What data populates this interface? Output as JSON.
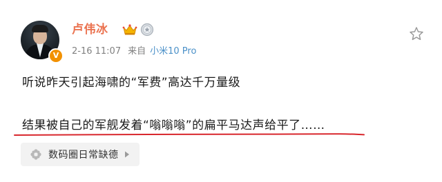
{
  "post": {
    "author": {
      "name": "卢伟冰",
      "verified_badge": "V"
    },
    "meta": {
      "time": "2-16 11:07",
      "source_prefix": "来自",
      "device": "小米10 Pro"
    },
    "content": {
      "line1": "听说昨天引起海啸的“军费”高达千万量级",
      "line2": "结果被自己的军舰发着“嗡嗡嗡”的扁平马达声给平了……"
    },
    "topic": {
      "label": "数码圈日常缺德"
    }
  },
  "colors": {
    "username": "#eb7350",
    "device_link": "#4a90c8",
    "underline": "#d8262c",
    "verified": "#f29100",
    "topic_bg": "#f2f2f2"
  },
  "icons": {
    "crown": "crown-icon",
    "medal": "medal-icon",
    "follow": "star-icon",
    "topic": "flower-icon",
    "chevron": "chevron-right-icon"
  }
}
